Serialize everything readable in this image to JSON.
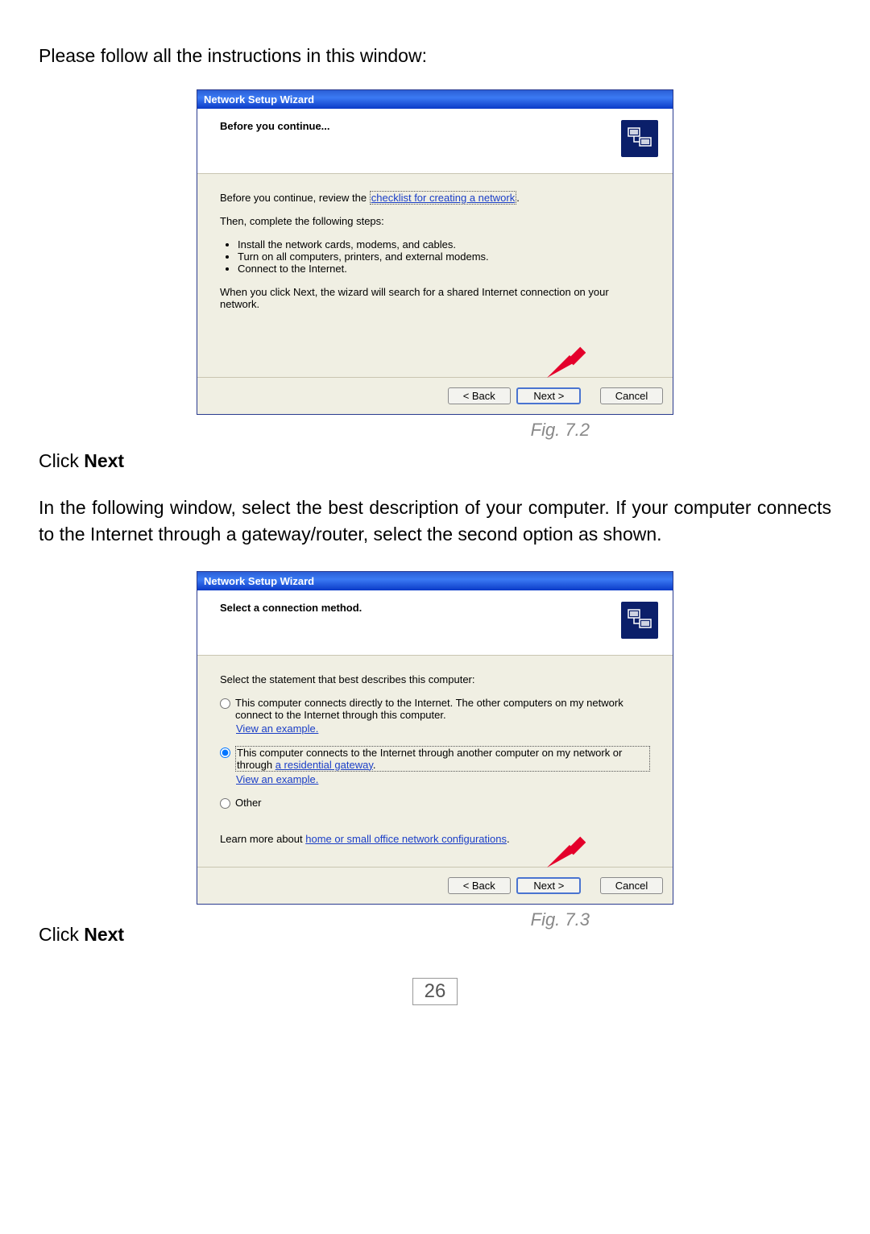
{
  "intro_text": "Please follow all the instructions in this window:",
  "click_next": "Click",
  "click_next_bold": "Next",
  "middle_paragraph": "In the following window, select the best description of your computer.  If your computer connects to the Internet through a gateway/router, select the second option as shown.",
  "page_number": "26",
  "figures": {
    "fig1": "Fig. 7.2",
    "fig2": "Fig. 7.3"
  },
  "wizard1": {
    "title": "Network Setup Wizard",
    "header": "Before you continue...",
    "line1_prefix": "Before you continue, review the ",
    "line1_link": "checklist for creating a network",
    "line2": "Then, complete the following steps:",
    "bullets": [
      "Install the network cards, modems, and cables.",
      "Turn on all computers, printers, and external modems.",
      "Connect to the Internet."
    ],
    "line3": "When you click Next, the wizard will search for a shared Internet connection on your network.",
    "buttons": {
      "back": "< Back",
      "next": "Next >",
      "cancel": "Cancel"
    }
  },
  "wizard2": {
    "title": "Network Setup Wizard",
    "header": "Select a connection method.",
    "prompt": "Select the statement that best describes this computer:",
    "option1": "This computer connects directly to the Internet. The other computers on my network connect to the Internet through this computer.",
    "option2_text": "This computer connects to the Internet through another computer on my network or through ",
    "option2_link": "a residential gateway",
    "option3": "Other",
    "view_example": "View an example.",
    "learn_more_prefix": "Learn more about ",
    "learn_more_link": "home or small office network configurations",
    "buttons": {
      "back": "< Back",
      "next": "Next >",
      "cancel": "Cancel"
    }
  }
}
